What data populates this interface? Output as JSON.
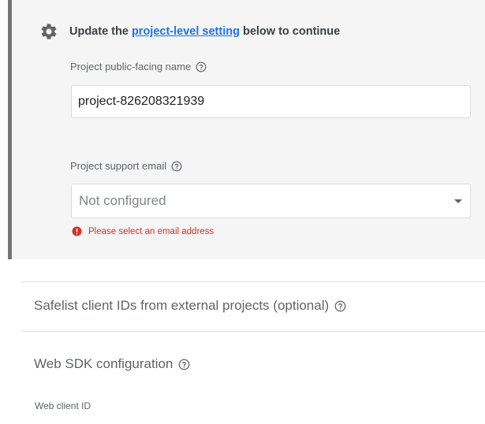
{
  "panel": {
    "header_prefix": "Update the ",
    "header_link": "project-level setting",
    "header_suffix": " below to continue",
    "public_name": {
      "label": "Project public-facing name",
      "value": "project-826208321939"
    },
    "support_email": {
      "label": "Project support email",
      "selected": "Not configured",
      "error": "Please select an email address"
    }
  },
  "safelist": {
    "title": "Safelist client IDs from external projects (optional)"
  },
  "web_sdk": {
    "title": "Web SDK configuration",
    "client_id_label": "Web client ID"
  },
  "colors": {
    "link": "#1a73e8",
    "error": "#d93025",
    "panel_bg": "#f5f5f5",
    "panel_border": "#757575"
  },
  "icons": {
    "header": "gear-icon",
    "help": "help-circle-icon",
    "error": "error-circle-icon",
    "dropdown": "caret-down-icon"
  }
}
